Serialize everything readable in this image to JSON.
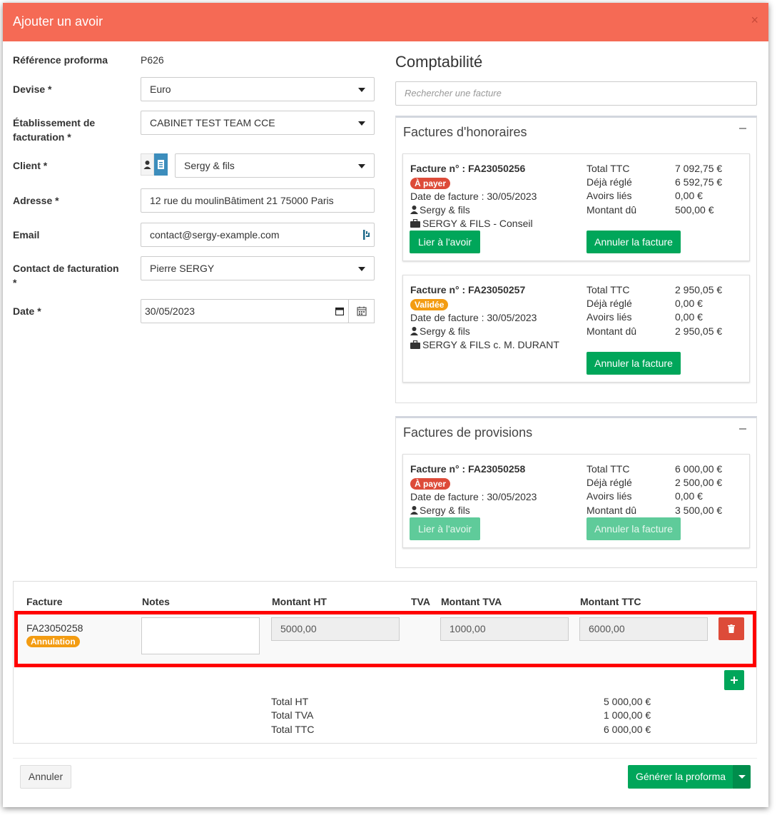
{
  "modal": {
    "title": "Ajouter un avoir",
    "close_label": "×"
  },
  "form": {
    "ref_label": "Référence proforma",
    "ref_value": "P626",
    "devise_label": "Devise *",
    "devise_value": "Euro",
    "etab_label_1": "Établissement de",
    "etab_label_2": "facturation *",
    "etab_value": "CABINET TEST TEAM CCE",
    "client_label": "Client *",
    "client_value": "Sergy & fils",
    "adresse_label": "Adresse *",
    "adresse_value": "12 rue du moulinBâtiment 21 75000 Paris",
    "email_label": "Email",
    "email_value": "contact@sergy-example.com",
    "contact_label_1": "Contact de facturation",
    "contact_label_2": "*",
    "contact_value": "Pierre SERGY",
    "date_label": "Date *",
    "date_value": "30/05/2023"
  },
  "compta": {
    "title": "Comptabilité",
    "search_placeholder": "Rechercher une facture",
    "honoraires_title": "Factures d'honoraires",
    "provisions_title": "Factures de provisions",
    "label_total_ttc": "Total TTC",
    "label_deja_regle": "Déjà réglé",
    "label_avoirs_lies": "Avoirs liés",
    "label_montant_du": "Montant dû",
    "invoices": [
      {
        "number": "Facture n° : FA23050256",
        "status": "À payer",
        "date": "Date de facture : 30/05/2023",
        "client": "Sergy & fils",
        "mission": "SERGY & FILS - Conseil",
        "total_ttc": "7 092,75 €",
        "deja_regle": "6 592,75 €",
        "avoirs_lies": "0,00 €",
        "montant_du": "500,00 €",
        "link_label": "Lier à l'avoir",
        "cancel_label": "Annuler la facture"
      },
      {
        "number": "Facture n° : FA23050257",
        "status": "Validée",
        "date": "Date de facture : 30/05/2023",
        "client": "Sergy & fils",
        "mission": "SERGY & FILS c. M. DURANT",
        "total_ttc": "2 950,05 €",
        "deja_regle": "0,00 €",
        "avoirs_lies": "0,00 €",
        "montant_du": "2 950,05 €",
        "cancel_label": "Annuler la facture"
      },
      {
        "number": "Facture n° : FA23050258",
        "status": "À payer",
        "date": "Date de facture : 30/05/2023",
        "client": "Sergy & fils",
        "total_ttc": "6 000,00 €",
        "deja_regle": "2 500,00 €",
        "avoirs_lies": "0,00 €",
        "montant_du": "3 500,00 €",
        "link_label": "Lier à l'avoir",
        "cancel_label": "Annuler la facture"
      }
    ]
  },
  "table": {
    "headers": {
      "facture": "Facture",
      "notes": "Notes",
      "montant_ht": "Montant HT",
      "tva": "TVA",
      "montant_tva": "Montant TVA",
      "montant_ttc": "Montant TTC"
    },
    "row": {
      "facture": "FA23050258",
      "badge": "Annulation",
      "notes": "",
      "montant_ht": "5000,00",
      "montant_tva": "1000,00",
      "montant_ttc": "6000,00"
    },
    "totals": {
      "ht_label": "Total HT",
      "ht_value": "5 000,00 €",
      "tva_label": "Total TVA",
      "tva_value": "1 000,00 €",
      "ttc_label": "Total TTC",
      "ttc_value": "6 000,00 €"
    }
  },
  "footer": {
    "cancel_label": "Annuler",
    "generate_label": "Générer la proforma"
  },
  "colors": {
    "header": "#f56a55",
    "green": "#00a65a",
    "red": "#dd4b39",
    "orange": "#f39c12",
    "highlight": "#ff0000"
  }
}
